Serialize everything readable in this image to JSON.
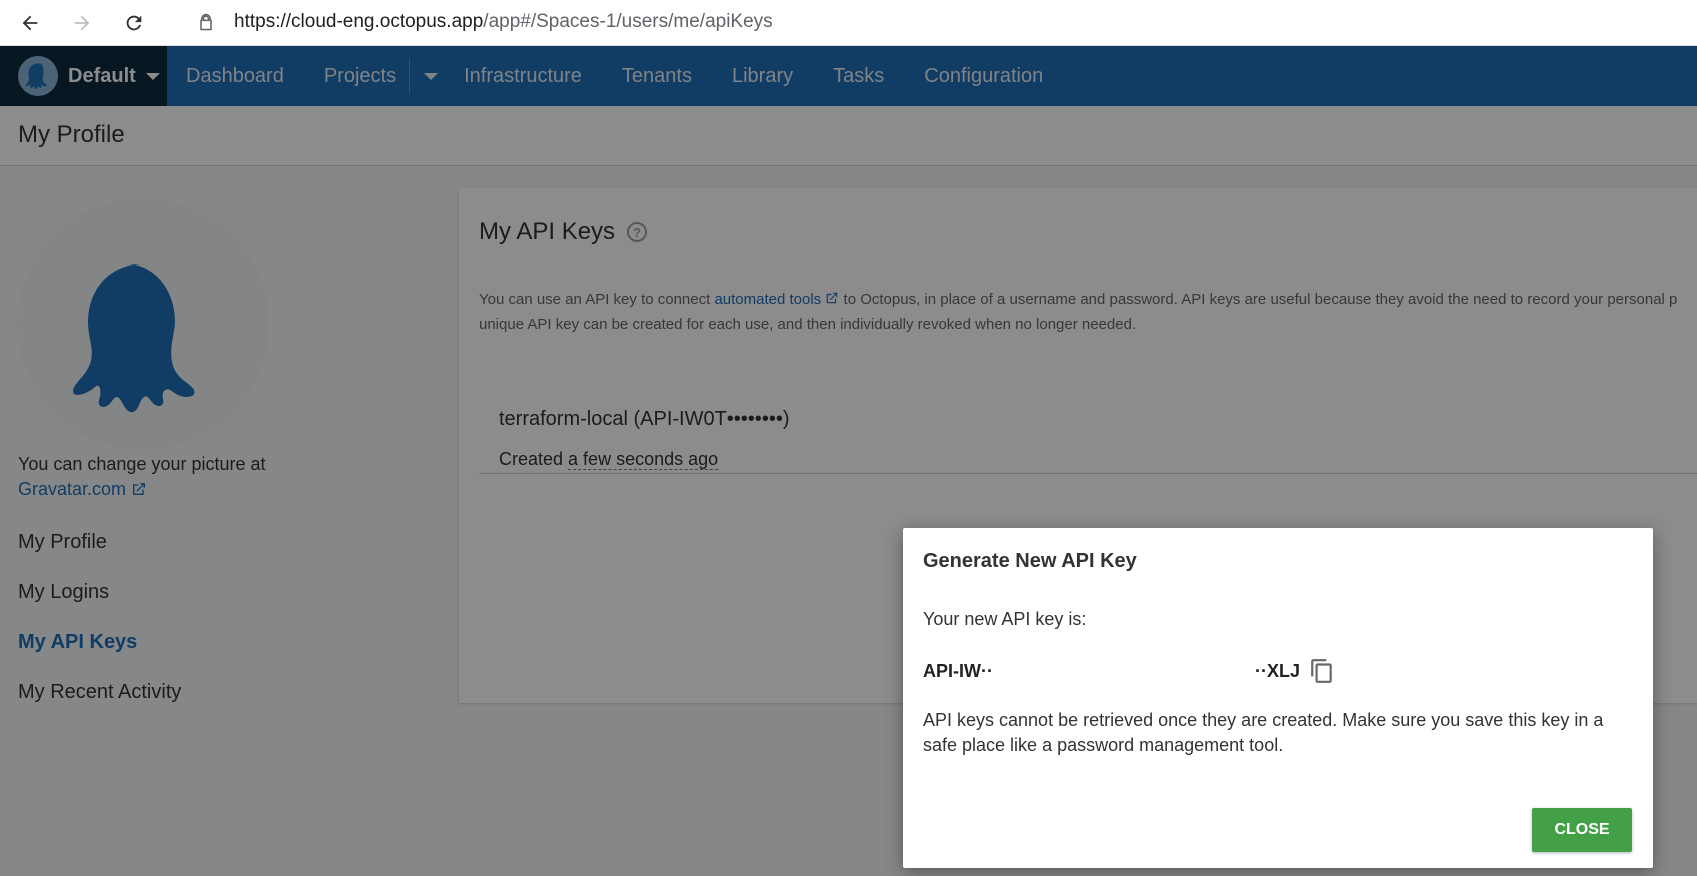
{
  "browser": {
    "url_host": "https://cloud-eng.octopus.app",
    "url_path": "/app#/Spaces-1/users/me/apiKeys"
  },
  "nav": {
    "space_name": "Default",
    "items": [
      "Dashboard",
      "Projects",
      "Infrastructure",
      "Tenants",
      "Library",
      "Tasks",
      "Configuration"
    ]
  },
  "page": {
    "title": "My Profile"
  },
  "sidebar": {
    "gravatar_text": "You can change your picture at",
    "gravatar_link": "Gravatar.com",
    "items": [
      {
        "label": "My Profile"
      },
      {
        "label": "My Logins"
      },
      {
        "label": "My API Keys"
      },
      {
        "label": "My Recent Activity"
      }
    ]
  },
  "card": {
    "title": "My API Keys",
    "desc_pre": "You can use an API key to connect ",
    "desc_link": "automated tools",
    "desc_post": " to Octopus, in place of a username and password. API keys are useful because they avoid the need to record your personal p",
    "desc_line2": "unique API key can be created for each use, and then individually revoked when no longer needed.",
    "key_name": "terraform-local (API-IW0T••••••••)",
    "created_prefix": "Created ",
    "created_time": "a few seconds ago"
  },
  "dialog": {
    "title": "Generate New API Key",
    "label": "Your new API key is:",
    "key_start": "API-IW··",
    "key_end": "··XLJ",
    "warning": "API keys cannot be retrieved once they are created. Make sure you save this key in a safe place like a password management tool.",
    "close_label": "CLOSE"
  },
  "colors": {
    "nav_bg": "#1f6eb5",
    "space_bg": "#0e2a3f",
    "accent": "#1f6eb5",
    "close_btn": "#43a047"
  }
}
